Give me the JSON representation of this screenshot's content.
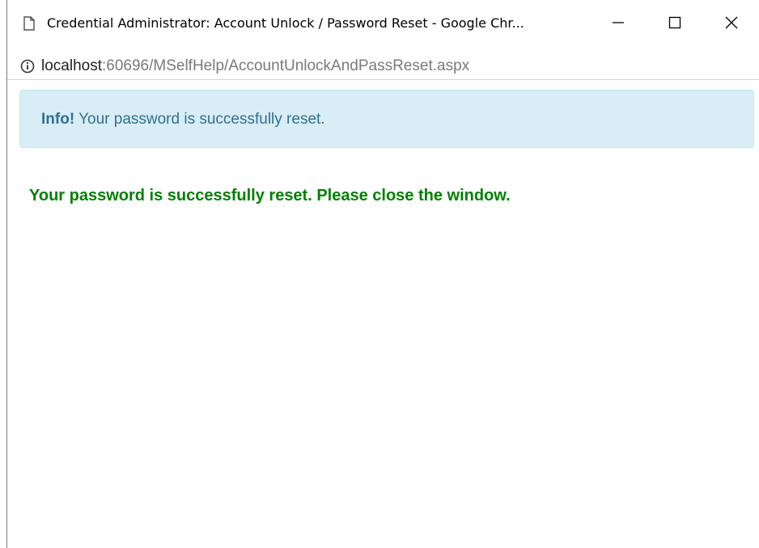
{
  "window": {
    "title": "Credential Administrator: Account Unlock / Password Reset - Google Chr...",
    "icon": "page-icon",
    "controls": {
      "minimize_icon": "minimize-icon",
      "maximize_icon": "maximize-icon",
      "close_icon": "close-icon"
    }
  },
  "address_bar": {
    "icon": "info-circle-icon",
    "host": "localhost",
    "path": ":60696/MSelfHelp/AccountUnlockAndPassReset.aspx"
  },
  "alert": {
    "strong": "Info!",
    "message": " Your password is successfully reset.",
    "background_color": "#d9edf7",
    "text_color": "#31708f"
  },
  "success_message": {
    "text": "Your password is successfully reset. Please close the window.",
    "color": "#008000"
  }
}
